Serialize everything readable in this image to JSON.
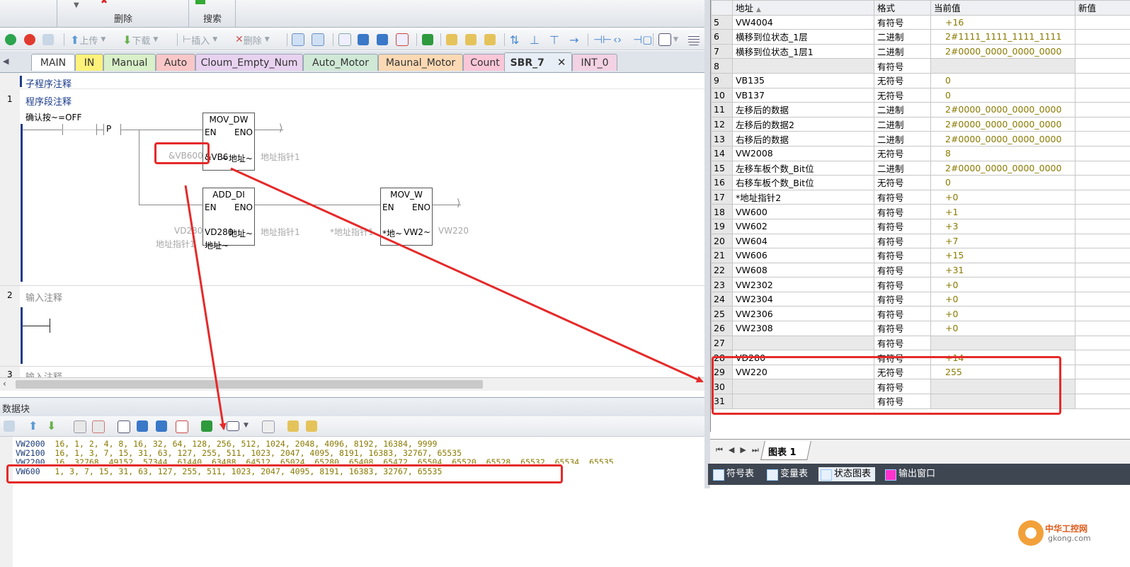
{
  "ribbon": {
    "group_delete_label": "删除",
    "group_search_label": "搜索",
    "cut_top_left": "",
    "cut_top_mid": "",
    "cut_top_right": ""
  },
  "toolbar": {
    "upload_label": "上传",
    "download_label": "下载",
    "insert_label": "插入",
    "delete_label": "删除"
  },
  "tabs": [
    {
      "label": "MAIN",
      "color": "#ffffff"
    },
    {
      "label": "IN",
      "color": "#fff27a"
    },
    {
      "label": "Manual",
      "color": "#d9f0c8"
    },
    {
      "label": "Auto",
      "color": "#f9c7c7"
    },
    {
      "label": "Cloum_Empty_Num",
      "color": "#e8d2f0"
    },
    {
      "label": "Auto_Motor",
      "color": "#cfe9d6"
    },
    {
      "label": "Maunal_Motor",
      "color": "#fbd9b4"
    },
    {
      "label": "Count",
      "color": "#f9c7d8"
    },
    {
      "label": "SBR_7",
      "color": "#e8eef5"
    },
    {
      "label": "INT_0",
      "color": "#f3d2e4"
    }
  ],
  "editor": {
    "subroutine_comment": "子程序注释",
    "network1_number": "1",
    "network1_comment": "程序段注释",
    "contact_label": "确认按~=OFF",
    "p_label": "P",
    "mov_dw": {
      "title": "MOV_DW",
      "en": "EN",
      "eno": "ENO",
      "in_grey": "&VB600",
      "in_value": "&VB6",
      "out_value": "~地址~",
      "out_grey": "地址指针1"
    },
    "add_di": {
      "title": "ADD_DI",
      "en": "EN",
      "eno": "ENO",
      "in1_grey": "VD280",
      "in1_value": "VD280",
      "in2_grey": "地址指针1",
      "in2_value": "地址~",
      "out_value": "地址~",
      "out_grey": "地址指针1"
    },
    "mov_w": {
      "title": "MOV_W",
      "en": "EN",
      "eno": "ENO",
      "in_grey": "*地址指针1",
      "in_value": "*地~",
      "out_value": "VW2~",
      "out_grey": "VW220"
    },
    "network2_number": "2",
    "network2_comment": "输入注释",
    "network3_number": "3",
    "network3_comment": "输入注释"
  },
  "datablock": {
    "title": "数据块",
    "lines": [
      {
        "addr": "VW2000",
        "values": "16, 1, 2, 4, 8, 16, 32, 64, 128, 256, 512, 1024, 2048, 4096, 8192, 16384, 9999"
      },
      {
        "addr": "VW2100",
        "values": "16, 1, 3, 7, 15, 31, 63, 127, 255, 511, 1023, 2047, 4095, 8191, 16383, 32767, 65535"
      },
      {
        "addr": "VW2200",
        "values": "16, 32768, 49152, 57344, 61440, 63488, 64512, 65024, 65280, 65408, 65472, 65504, 65520, 65528, 65532, 65534, 65535"
      },
      {
        "addr": "VW600",
        "values": "1, 3, 7, 15, 31, 63, 127, 255, 511, 1023, 2047, 4095, 8191, 16383, 32767, 65535"
      }
    ]
  },
  "status_table": {
    "headers": {
      "address": "地址",
      "format": "格式",
      "current": "当前值",
      "new": "新值"
    },
    "rows": [
      {
        "num": "5",
        "address": "VW4004",
        "format": "有符号",
        "value": "+16"
      },
      {
        "num": "6",
        "address": "横移到位状态_1层",
        "format": "二进制",
        "value": "2#1111_1111_1111_1111"
      },
      {
        "num": "7",
        "address": "横移到位状态_1层1",
        "format": "二进制",
        "value": "2#0000_0000_0000_0000"
      },
      {
        "num": "8",
        "address": "",
        "format": "有符号",
        "value": ""
      },
      {
        "num": "9",
        "address": "VB135",
        "format": "无符号",
        "value": "0"
      },
      {
        "num": "10",
        "address": "VB137",
        "format": "无符号",
        "value": "0"
      },
      {
        "num": "11",
        "address": "左移后的数据",
        "format": "二进制",
        "value": "2#0000_0000_0000_0000"
      },
      {
        "num": "12",
        "address": "左移后的数据2",
        "format": "二进制",
        "value": "2#0000_0000_0000_0000"
      },
      {
        "num": "13",
        "address": "右移后的数据",
        "format": "二进制",
        "value": "2#0000_0000_0000_0000"
      },
      {
        "num": "14",
        "address": "VW2008",
        "format": "无符号",
        "value": "8"
      },
      {
        "num": "15",
        "address": "左移车板个数_Bit位",
        "format": "二进制",
        "value": "2#0000_0000_0000_0000"
      },
      {
        "num": "16",
        "address": "右移车板个数_Bit位",
        "format": "无符号",
        "value": "0"
      },
      {
        "num": "17",
        "address": "*地址指针2",
        "format": "有符号",
        "value": "+0"
      },
      {
        "num": "18",
        "address": "VW600",
        "format": "有符号",
        "value": "+1"
      },
      {
        "num": "19",
        "address": "VW602",
        "format": "有符号",
        "value": "+3"
      },
      {
        "num": "20",
        "address": "VW604",
        "format": "有符号",
        "value": "+7"
      },
      {
        "num": "21",
        "address": "VW606",
        "format": "有符号",
        "value": "+15"
      },
      {
        "num": "22",
        "address": "VW608",
        "format": "有符号",
        "value": "+31"
      },
      {
        "num": "23",
        "address": "VW2302",
        "format": "有符号",
        "value": "+0"
      },
      {
        "num": "24",
        "address": "VW2304",
        "format": "有符号",
        "value": "+0"
      },
      {
        "num": "25",
        "address": "VW2306",
        "format": "有符号",
        "value": "+0"
      },
      {
        "num": "26",
        "address": "VW2308",
        "format": "有符号",
        "value": "+0"
      },
      {
        "num": "27",
        "address": "",
        "format": "有符号",
        "value": ""
      },
      {
        "num": "28",
        "address": "VD280",
        "format": "有符号",
        "value": "+14"
      },
      {
        "num": "29",
        "address": "VW220",
        "format": "无符号",
        "value": "255"
      },
      {
        "num": "30",
        "address": "",
        "format": "有符号",
        "value": ""
      },
      {
        "num": "31",
        "address": "",
        "format": "有符号",
        "value": ""
      }
    ],
    "sheet_tab": "图表 1"
  },
  "bottom_tabs": [
    {
      "label": "符号表"
    },
    {
      "label": "变量表"
    },
    {
      "label": "状态图表"
    },
    {
      "label": "输出窗口"
    }
  ],
  "watermark": {
    "line1": "中华工控网",
    "line2": "gkong.com"
  },
  "colors": {
    "annotation_red": "#e52a2a",
    "value_olive": "#8a7a00",
    "rail_blue": "#1d3a8a"
  }
}
